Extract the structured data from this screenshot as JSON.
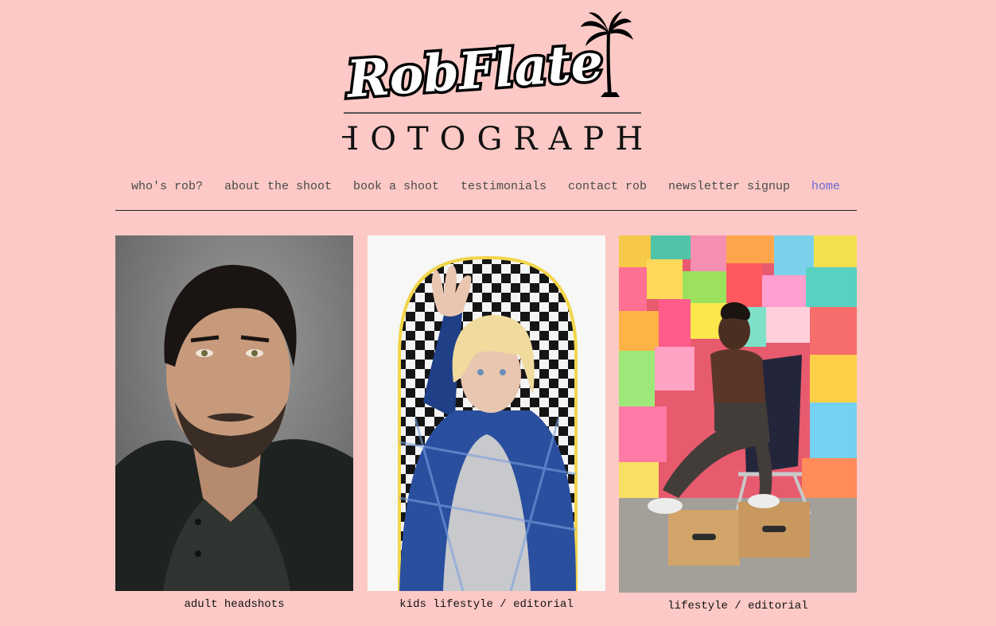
{
  "header": {
    "logo_script": "RobFlate",
    "logo_subtitle": "PHOTOGRAPHY",
    "logo_icon": "palm-tree-icon"
  },
  "nav": {
    "items": [
      {
        "label": "who's rob?"
      },
      {
        "label": "about the shoot"
      },
      {
        "label": "book a shoot"
      },
      {
        "label": "testimonials"
      },
      {
        "label": "contact rob"
      },
      {
        "label": "newsletter signup"
      },
      {
        "label": "home",
        "active": true
      }
    ]
  },
  "gallery": {
    "cards": [
      {
        "caption": "adult headshots"
      },
      {
        "caption": "kids lifestyle / editorial"
      },
      {
        "caption": "lifestyle / editorial"
      }
    ]
  },
  "colors": {
    "background": "#fcc9c6",
    "nav_text": "#4a4a4a",
    "nav_active": "#6b6bd6"
  }
}
